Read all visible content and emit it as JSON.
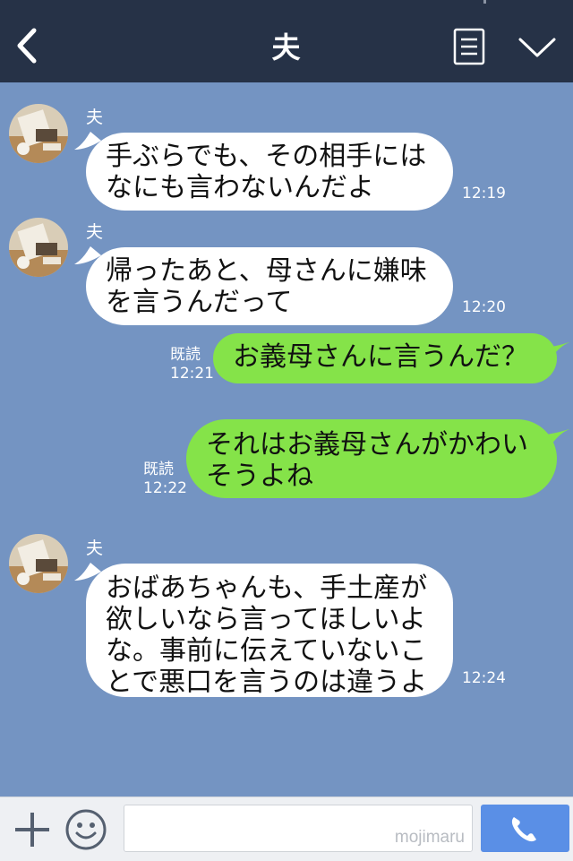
{
  "header": {
    "title": "夫",
    "back_icon": "chevron-left-icon",
    "menu_icon": "notes-icon",
    "down_icon": "chevron-down-icon"
  },
  "colors": {
    "header_bg": "#263247",
    "chat_bg": "#7494c2",
    "incoming_bubble": "#ffffff",
    "outgoing_bubble": "#85e349",
    "call_button": "#5a8fe6"
  },
  "messages": [
    {
      "direction": "incoming",
      "sender": "夫",
      "text": "手ぶらでも、その相手には\nなにも言わないんだよ",
      "time": "12:19"
    },
    {
      "direction": "incoming",
      "sender": "夫",
      "text": "帰ったあと、母さんに嫌味\nを言うんだって",
      "time": "12:20"
    },
    {
      "direction": "outgoing",
      "read": "既読",
      "text": "お義母さんに言うんだ？",
      "time": "12:21"
    },
    {
      "direction": "outgoing",
      "read": "既読",
      "text": "それはお義母さんがかわい\nそうよね",
      "time": "12:22"
    },
    {
      "direction": "incoming",
      "sender": "夫",
      "text": "おばあちゃんも、手土産が\n欲しいなら言ってほしいよ\nな。事前に伝えていないこ\nとで悪口を言うのは違うよ",
      "time": "12:24"
    }
  ],
  "footer": {
    "plus_icon": "plus-icon",
    "emoji_icon": "smiley-icon",
    "input_value": "",
    "watermark": "mojimaru",
    "call_icon": "phone-icon"
  }
}
